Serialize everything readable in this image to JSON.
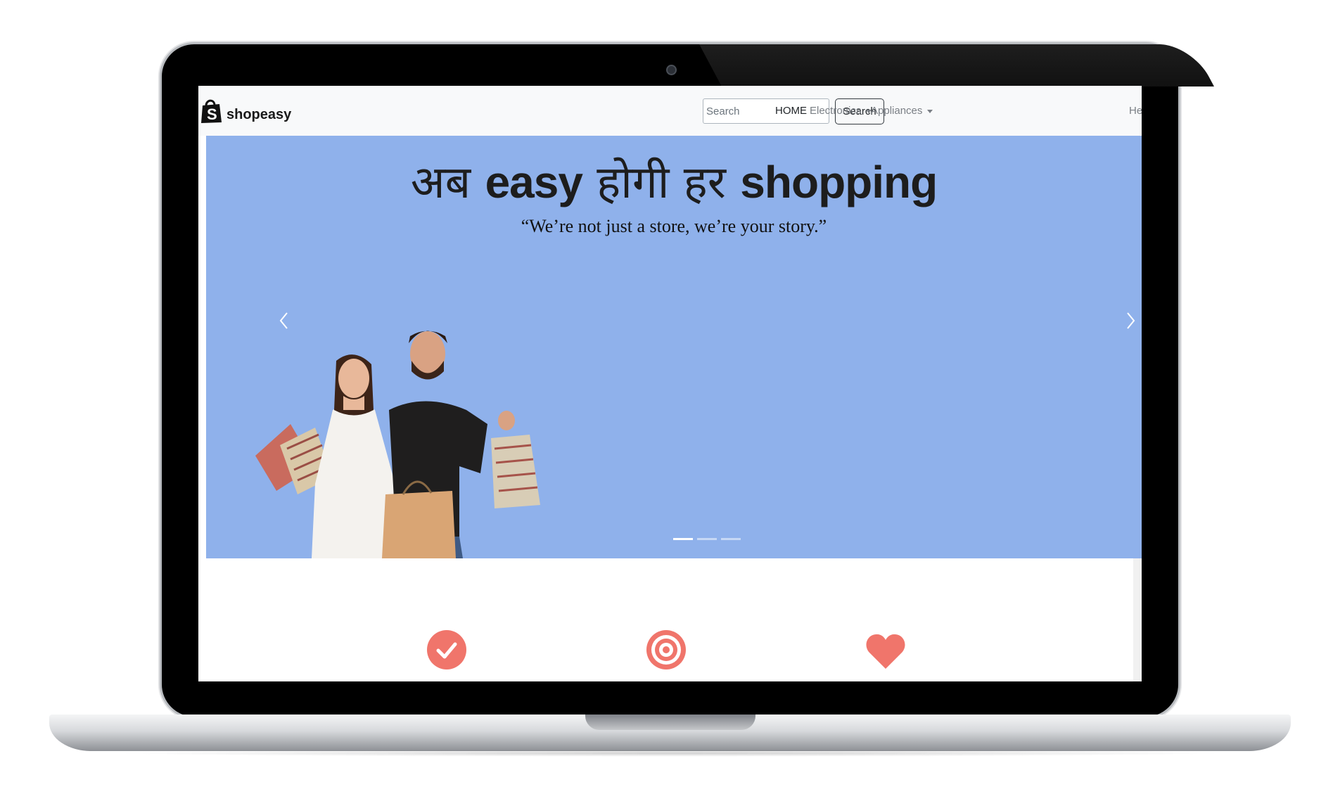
{
  "brand": {
    "name": "shopeasy",
    "logo_icon": "shopping-bag-logo-icon"
  },
  "search": {
    "placeholder": "Search",
    "button_label": "Search"
  },
  "nav": {
    "home": "HOME",
    "electronics": "Electronics",
    "appliances": "Appliances",
    "help": "He"
  },
  "hero": {
    "title_part1": "अब ",
    "title_part2": "easy",
    "title_part3": " होगी हर ",
    "title_part4": "shopping",
    "tagline": "“We’re not just a store, we’re your story.”",
    "slide_count": 3,
    "active_slide": 1,
    "background_color": "#8fb1eb"
  },
  "features": [
    {
      "icon": "check-circle-icon",
      "color": "#f0756b"
    },
    {
      "icon": "target-icon",
      "color": "#f0756b"
    },
    {
      "icon": "heart-icon",
      "color": "#f0756b"
    }
  ]
}
